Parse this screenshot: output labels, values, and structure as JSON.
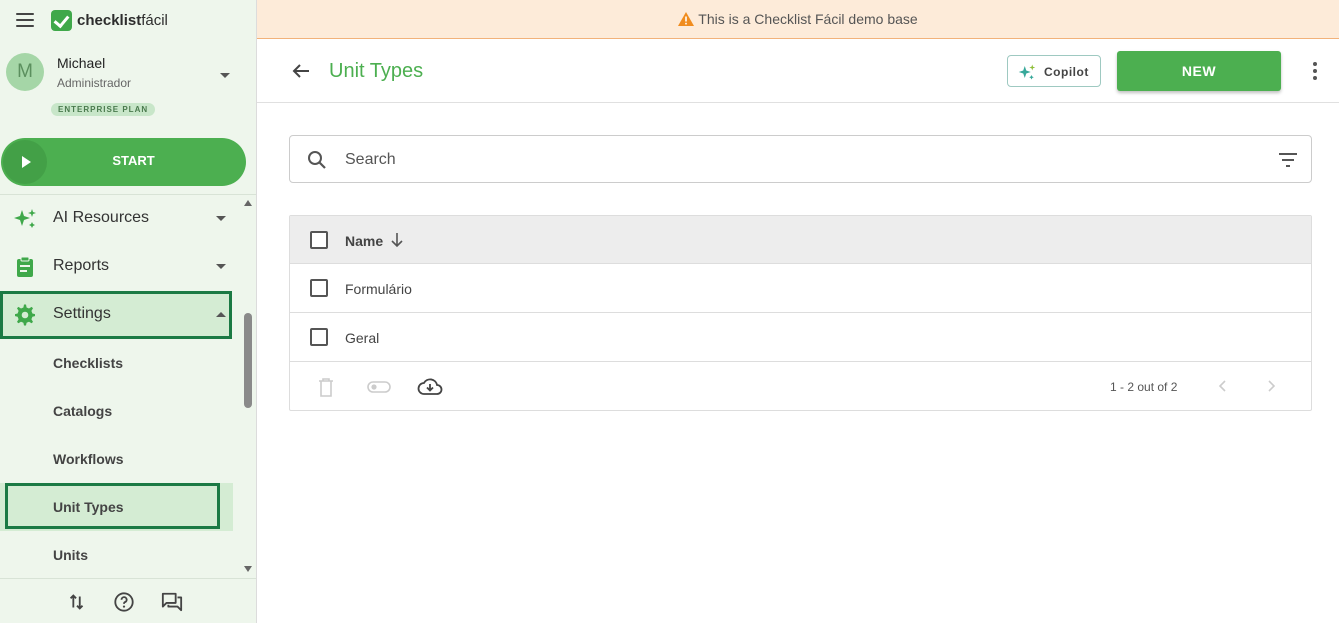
{
  "brand": {
    "logo_bold": "checklist",
    "logo_light": "fácil"
  },
  "user": {
    "initial": "M",
    "name": "Michael",
    "role": "Administrador",
    "plan": "ENTERPRISE PLAN"
  },
  "start_label": "START",
  "nav": {
    "ai_resources": "AI Resources",
    "reports": "Reports",
    "settings": "Settings",
    "sub_items": [
      "Checklists",
      "Catalogs",
      "Workflows",
      "Unit Types",
      "Units"
    ]
  },
  "banner": {
    "text": "This is a Checklist Fácil demo base"
  },
  "header": {
    "title": "Unit Types",
    "copilot_label": "Copilot",
    "new_label": "NEW"
  },
  "search": {
    "placeholder": "Search",
    "value": ""
  },
  "table": {
    "column_name": "Name",
    "rows": [
      "Formulário",
      "Geral"
    ],
    "pagination": "1 - 2 out of 2"
  },
  "colors": {
    "accent": "#4caf50",
    "highlight_box": "#1b7a44",
    "banner_bg": "#fdebd9",
    "sidebar_bg": "#eef6ec"
  },
  "icons": [
    "menu-icon",
    "play-icon",
    "sparkles-icon",
    "clipboard-icon",
    "gear-icon",
    "sort-icon",
    "help-icon",
    "chat-icon",
    "back-arrow-icon",
    "search-icon",
    "filter-icon",
    "trash-icon",
    "toggle-icon",
    "cloud-download-icon",
    "chevron-left-icon",
    "chevron-right-icon",
    "warning-icon"
  ]
}
